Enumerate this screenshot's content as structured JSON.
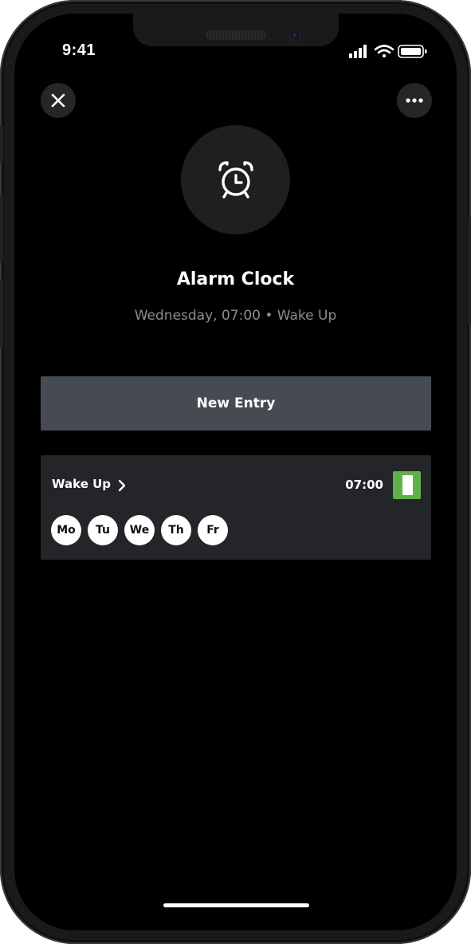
{
  "status_bar": {
    "time": "9:41",
    "icons": [
      "signal-icon",
      "wifi-icon",
      "battery-icon"
    ]
  },
  "header": {
    "close_icon": "close-icon",
    "more_icon": "more-icon"
  },
  "hero": {
    "icon": "alarm-clock-icon",
    "title": "Alarm Clock",
    "subtitle": "Wednesday, 07:00 • Wake Up"
  },
  "actions": {
    "new_entry_label": "New Entry"
  },
  "alarms": [
    {
      "name": "Wake Up",
      "time": "07:00",
      "enabled": true,
      "days": [
        "Mo",
        "Tu",
        "We",
        "Th",
        "Fr"
      ]
    }
  ],
  "colors": {
    "background": "#000000",
    "card": "#232528",
    "button": "#464b52",
    "toggle_on": "#5fb14a",
    "subtitle": "#8a8d94"
  }
}
